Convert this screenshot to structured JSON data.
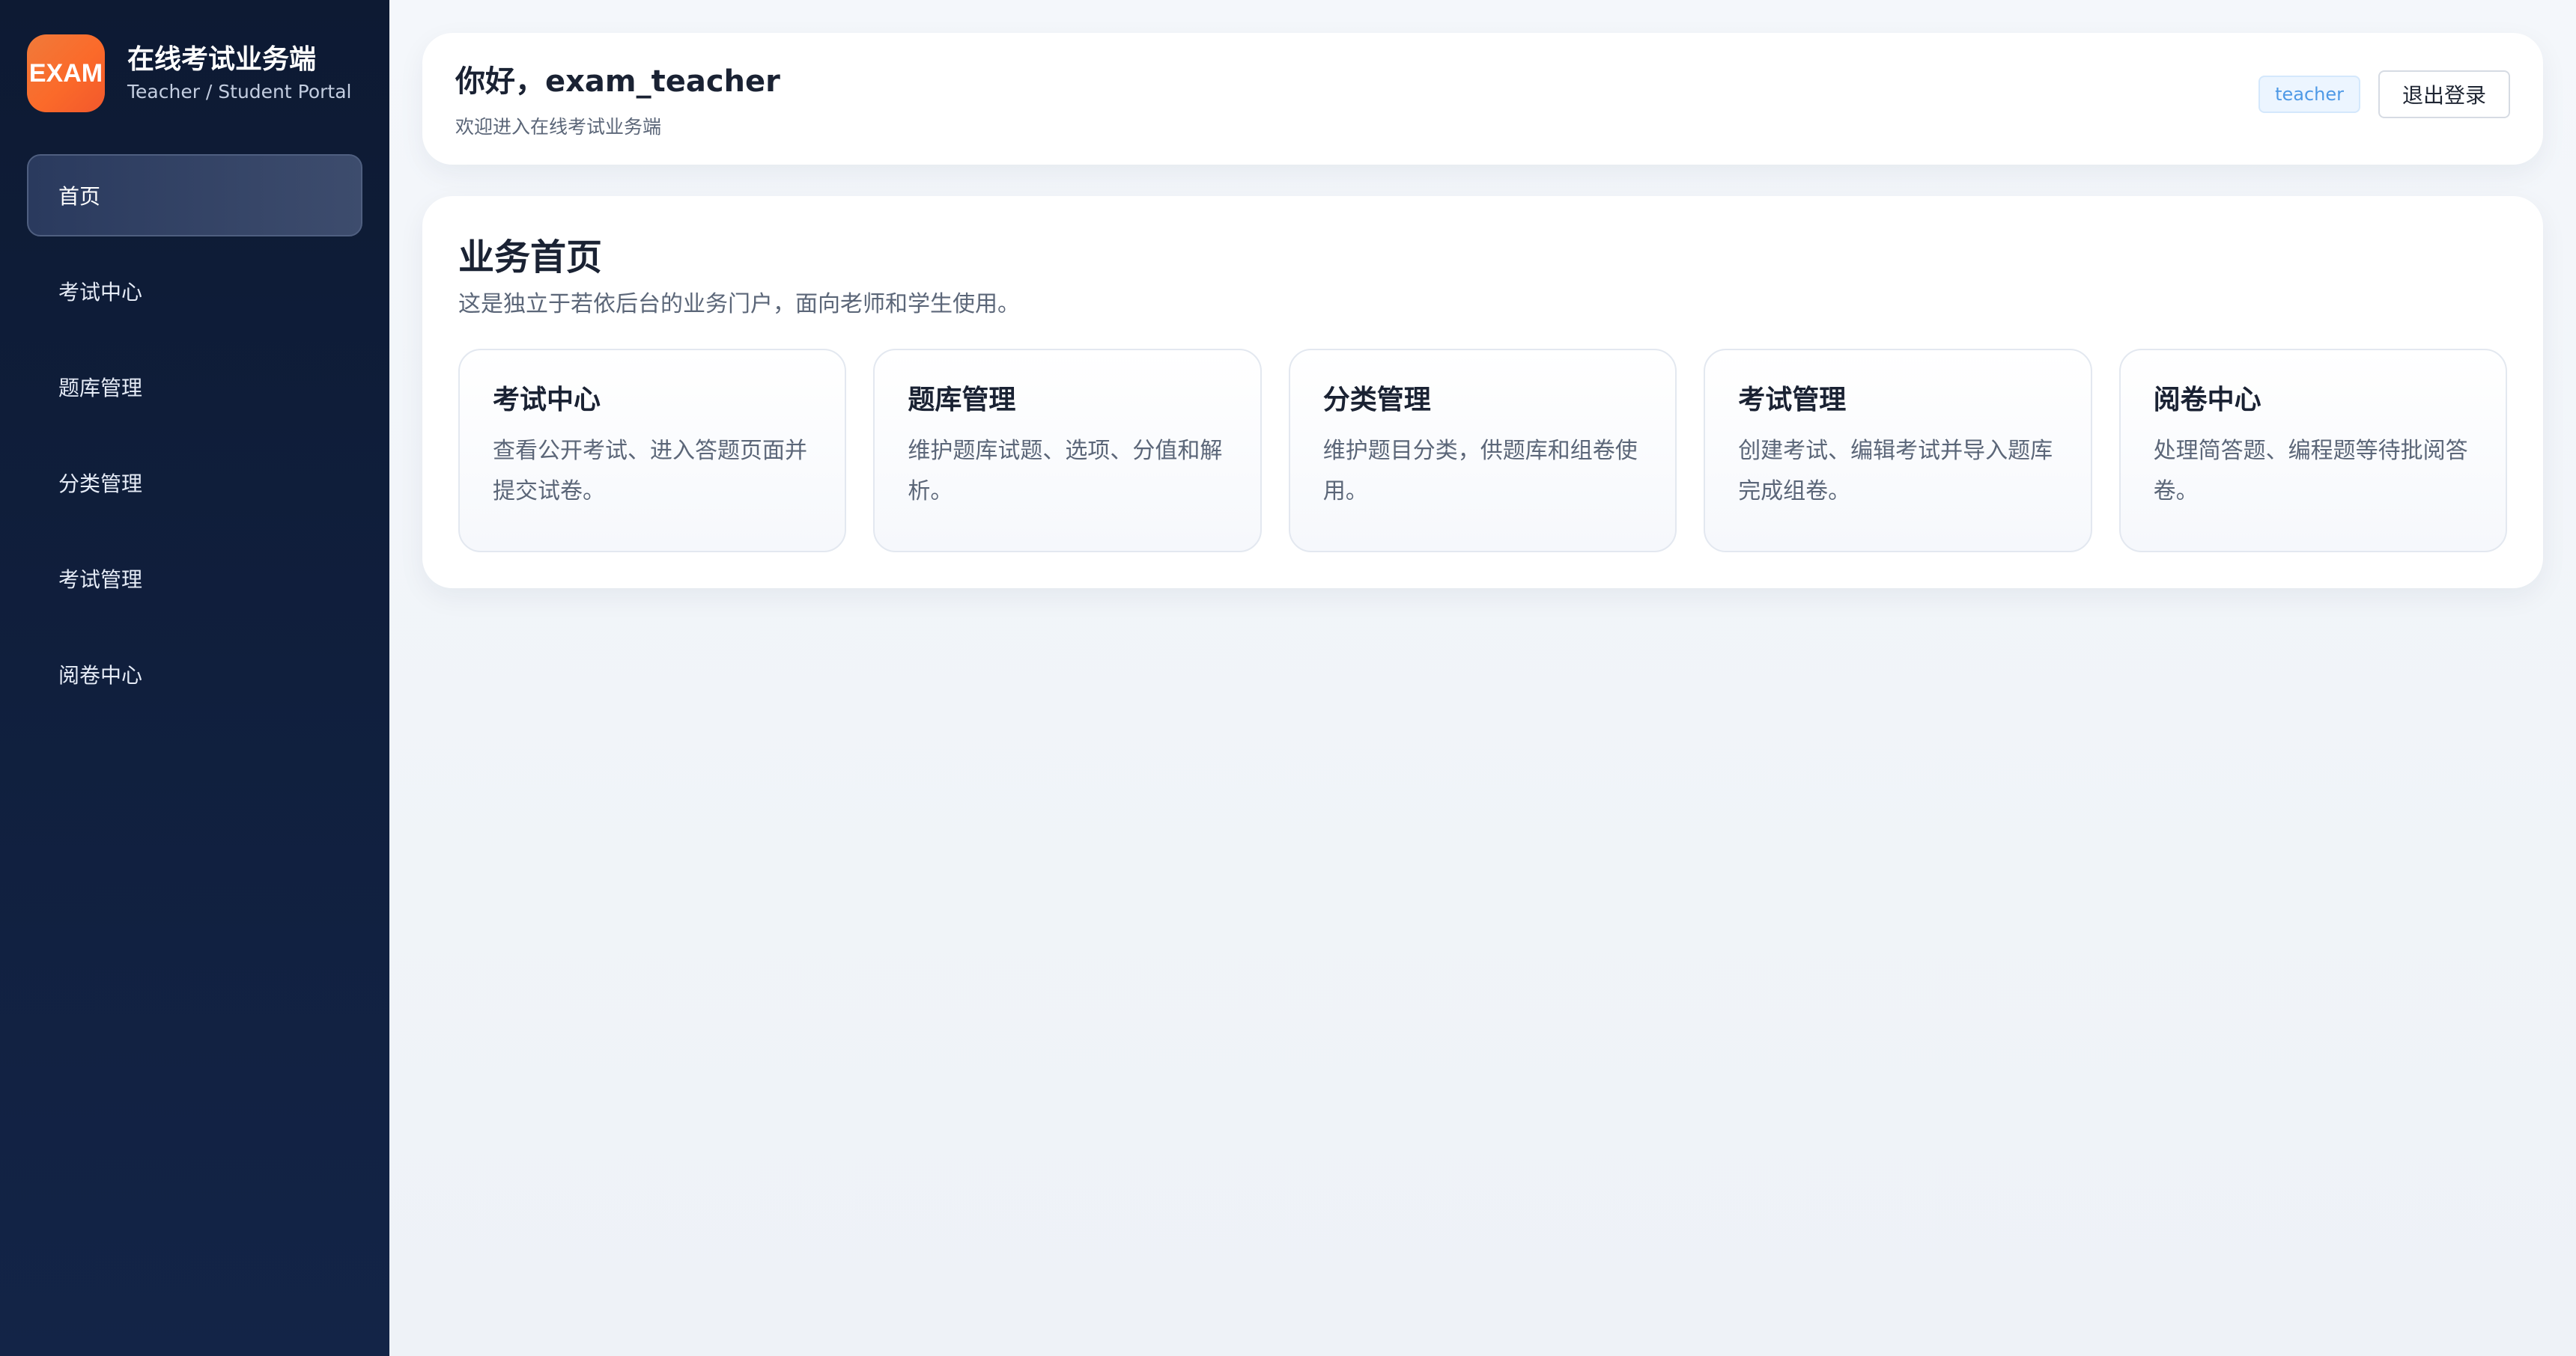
{
  "brand": {
    "logo_text": "EXAM",
    "title": "在线考试业务端",
    "subtitle": "Teacher / Student Portal"
  },
  "sidebar": {
    "items": [
      {
        "label": "首页",
        "active": true
      },
      {
        "label": "考试中心",
        "active": false
      },
      {
        "label": "题库管理",
        "active": false
      },
      {
        "label": "分类管理",
        "active": false
      },
      {
        "label": "考试管理",
        "active": false
      },
      {
        "label": "阅卷中心",
        "active": false
      }
    ]
  },
  "header": {
    "greeting": "你好，exam_teacher",
    "welcome": "欢迎进入在线考试业务端",
    "role_badge": "teacher",
    "logout_label": "退出登录"
  },
  "main": {
    "title": "业务首页",
    "description": "这是独立于若依后台的业务门户，面向老师和学生使用。",
    "cards": [
      {
        "title": "考试中心",
        "description": "查看公开考试、进入答题页面并提交试卷。"
      },
      {
        "title": "题库管理",
        "description": "维护题库试题、选项、分值和解析。"
      },
      {
        "title": "分类管理",
        "description": "维护题目分类，供题库和组卷使用。"
      },
      {
        "title": "考试管理",
        "description": "创建考试、编辑考试并导入题库完成组卷。"
      },
      {
        "title": "阅卷中心",
        "description": "处理简答题、编程题等待批阅答卷。"
      }
    ]
  },
  "colors": {
    "sidebar_bg": "#0d1a33",
    "logo_orange": "#fb6a2a",
    "badge_blue": "#4e99e6",
    "page_bg": "#f2f5fa"
  }
}
